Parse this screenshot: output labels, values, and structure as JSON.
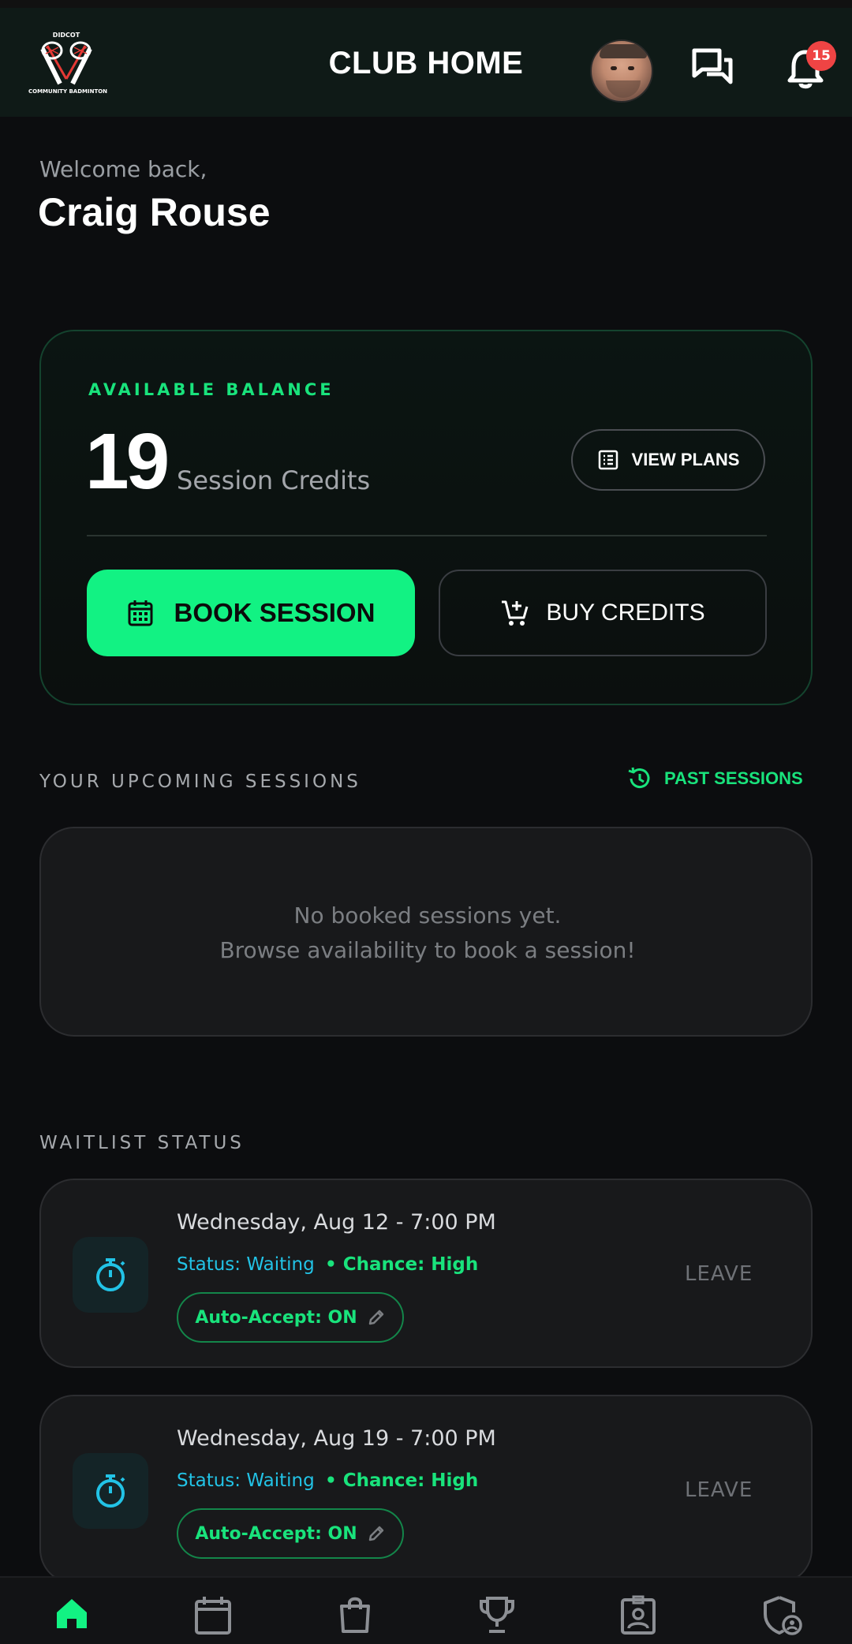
{
  "header": {
    "title": "CLUB HOME",
    "logo_top": "DIDCOT",
    "logo_bottom": "COMMUNITY BADMINTON",
    "notification_count": "15"
  },
  "welcome": {
    "greeting": "Welcome back,",
    "name": "Craig Rouse"
  },
  "balance": {
    "label": "AVAILABLE BALANCE",
    "credits": "19",
    "unit": "Session Credits",
    "view_plans": "VIEW PLANS",
    "book_session": "BOOK SESSION",
    "buy_credits": "BUY CREDITS"
  },
  "upcoming": {
    "title": "YOUR UPCOMING SESSIONS",
    "past_link": "PAST SESSIONS",
    "empty_line1": "No booked sessions yet.",
    "empty_line2": "Browse availability to book a session!"
  },
  "waitlist": {
    "title": "WAITLIST STATUS",
    "items": [
      {
        "date": "Wednesday, Aug 12 - 7:00 PM",
        "status": "Status: Waiting",
        "chance": "• Chance: High",
        "auto_accept": "Auto-Accept: ON",
        "leave": "LEAVE"
      },
      {
        "date": "Wednesday, Aug 19 - 7:00 PM",
        "status": "Status: Waiting",
        "chance": "• Chance: High",
        "auto_accept": "Auto-Accept: ON",
        "leave": "LEAVE"
      }
    ]
  },
  "nav": {
    "items": [
      "home-icon",
      "calendar-icon",
      "shop-bag-icon",
      "trophy-icon",
      "profile-badge-icon",
      "admin-shield-icon"
    ],
    "active": "home-icon"
  },
  "colors": {
    "accent": "#12f283",
    "status_blue": "#22c3e6",
    "badge_red": "#ef4444",
    "background": "#0c0d0f"
  }
}
